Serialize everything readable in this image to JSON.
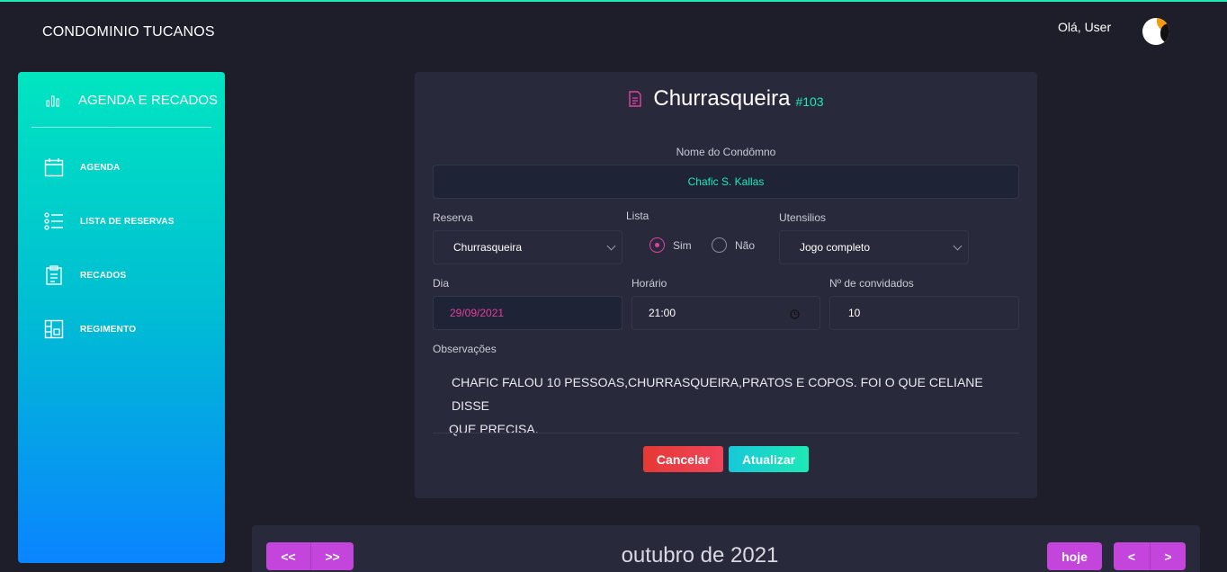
{
  "header": {
    "brand": "CONDOMINIO TUCANOS",
    "greeting": "Olá, User"
  },
  "sidebar": {
    "title": "AGENDA E RECADOS",
    "items": [
      {
        "label": "AGENDA",
        "icon": "calendar-icon"
      },
      {
        "label": "LISTA DE RESERVAS",
        "icon": "list-icon"
      },
      {
        "label": "RECADOS",
        "icon": "clipboard-icon"
      },
      {
        "label": "REGIMENTO",
        "icon": "layout-icon"
      }
    ]
  },
  "form": {
    "title": "Churrasqueira",
    "number": "#103",
    "nome_label": "Nome do Condômno",
    "nome_value": "Chafic S. Kallas",
    "reserva_label": "Reserva",
    "reserva_value": "Churrasqueira",
    "lista_label": "Lista",
    "lista_sim": "Sim",
    "lista_nao": "Não",
    "lista_selected": "Sim",
    "utensilios_label": "Utensilios",
    "utensilios_value": "Jogo completo",
    "dia_label": "Dia",
    "dia_value": "29/09/2021",
    "horario_label": "Horário",
    "horario_value": "21:00",
    "convidados_label": "Nº de convidados",
    "convidados_value": "10",
    "obs_label": "Observações",
    "obs_line1": "CHAFIC FALOU 10 PESSOAS,CHURRASQUEIRA,PRATOS E COPOS. FOI O QUE CELIANE DISSE",
    "obs_line2": "QUE PRECISA.",
    "cancel_label": "Cancelar",
    "update_label": "Atualizar"
  },
  "calendar": {
    "title": "outubro de 2021",
    "prev_year": "<<",
    "next_year": ">>",
    "today": "hoje",
    "prev": "<",
    "next": ">"
  },
  "colors": {
    "accent_teal": "#1de9b6",
    "accent_pink": "#e040a0",
    "button_purple": "#c445dc",
    "cancel_red": "#e53935"
  }
}
